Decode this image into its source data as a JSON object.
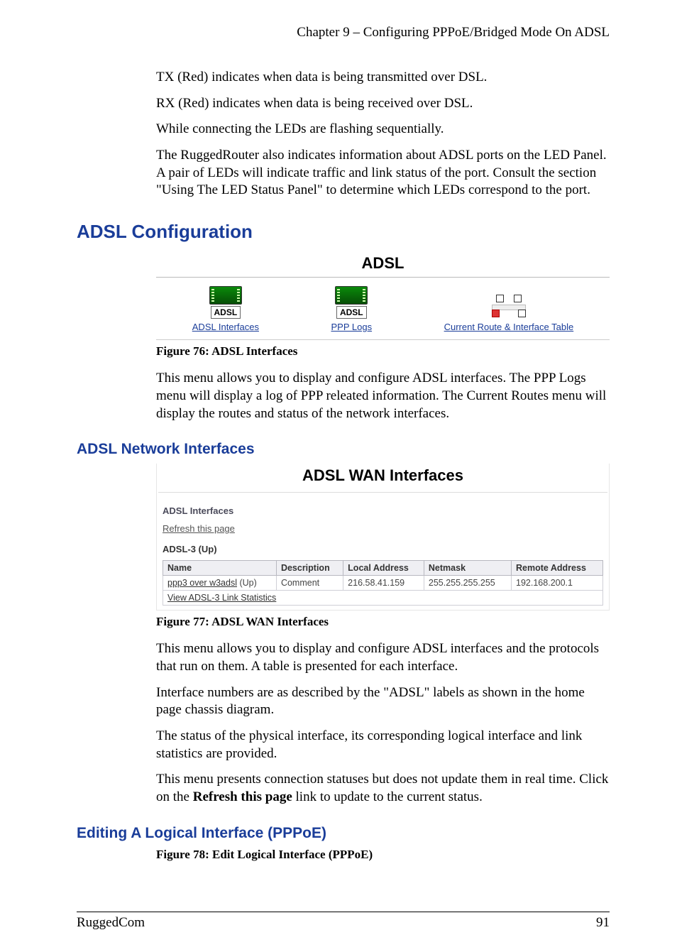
{
  "header": {
    "chapter": "Chapter 9 – Configuring PPPoE/Bridged Mode On ADSL"
  },
  "intro_paragraphs": [
    "TX (Red) indicates when data is being transmitted over DSL.",
    "RX (Red) indicates when data is being received over DSL.",
    "While connecting the LEDs are flashing sequentially.",
    "The RuggedRouter also indicates information about ADSL ports on the LED Panel.  A pair of LEDs will indicate traffic and link status of the port.  Consult the section \"Using The LED Status Panel\" to determine which LEDs correspond to the port."
  ],
  "section1": {
    "heading": "ADSL Configuration",
    "panel_title": "ADSL",
    "icons": {
      "badge": "ADSL",
      "link1": "ADSL Interfaces",
      "link2": "PPP Logs",
      "link3": "Current Route & Interface Table"
    },
    "figure_caption": "Figure 76: ADSL Interfaces",
    "body": "This menu allows you to display and configure ADSL interfaces.  The PPP Logs menu will display a log of PPP releated information.  The Current Routes menu will display the routes and status of the network interfaces."
  },
  "section2": {
    "heading": "ADSL Network Interfaces",
    "panel_title": "ADSL WAN Interfaces",
    "group_title": "ADSL Interfaces",
    "refresh": "Refresh this page",
    "iface_label": "ADSL-3 (Up)",
    "columns": [
      "Name",
      "Description",
      "Local Address",
      "Netmask",
      "Remote Address"
    ],
    "row": {
      "name": "ppp3 over w3adsl",
      "status": "(Up)",
      "description": "Comment",
      "local": "216.58.41.159",
      "netmask": "255.255.255.255",
      "remote": "192.168.200.1"
    },
    "stats_link": "View ADSL-3 Link Statistics",
    "figure_caption": "Figure 77: ADSL WAN Interfaces",
    "body": [
      "This menu allows you to display and configure ADSL interfaces and the protocols that run on them.  A table is presented for each interface.",
      "Interface numbers are as described by the \"ADSL\" labels as shown in the home page chassis diagram.",
      "The status of the physical interface, its corresponding logical interface and  link statistics are provided."
    ],
    "body_last_pre": "This menu presents connection statuses but does not update them in real time.  Click on the ",
    "body_last_bold": "Refresh this page",
    "body_last_post": " link to update to the current status."
  },
  "section3": {
    "heading": "Editing A Logical Interface (PPPoE)",
    "figure_caption": "Figure 78: Edit Logical Interface (PPPoE)"
  },
  "footer": {
    "left": "RuggedCom",
    "right": "91"
  }
}
